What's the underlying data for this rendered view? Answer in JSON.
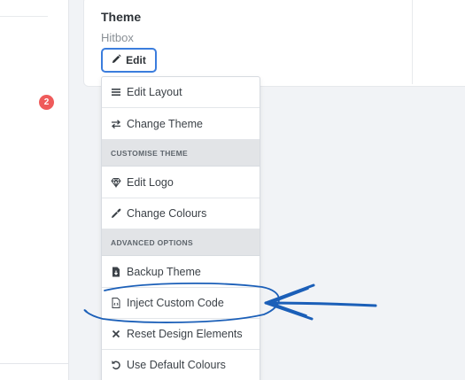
{
  "sidebar": {
    "notification_count": "2"
  },
  "theme_card": {
    "title": "Theme",
    "theme_name": "Hitbox",
    "edit_label": "Edit"
  },
  "menu": {
    "items_top": [
      {
        "label": "Edit Layout",
        "icon": "list-icon"
      },
      {
        "label": "Change Theme",
        "icon": "swap-arrows-icon"
      }
    ],
    "section_customise": "CUSTOMISE THEME",
    "items_customise": [
      {
        "label": "Edit Logo",
        "icon": "diamond-icon"
      },
      {
        "label": "Change Colours",
        "icon": "eyedropper-icon"
      }
    ],
    "section_advanced": "ADVANCED OPTIONS",
    "items_advanced": [
      {
        "label": "Backup Theme",
        "icon": "file-download-icon"
      },
      {
        "label": "Inject Custom Code",
        "icon": "file-code-icon"
      },
      {
        "label": "Reset Design Elements",
        "icon": "x-icon"
      },
      {
        "label": "Use Default Colours",
        "icon": "undo-icon"
      }
    ]
  },
  "annotation": {
    "color": "#1b5fb8",
    "highlighted_item": "Inject Custom Code"
  }
}
